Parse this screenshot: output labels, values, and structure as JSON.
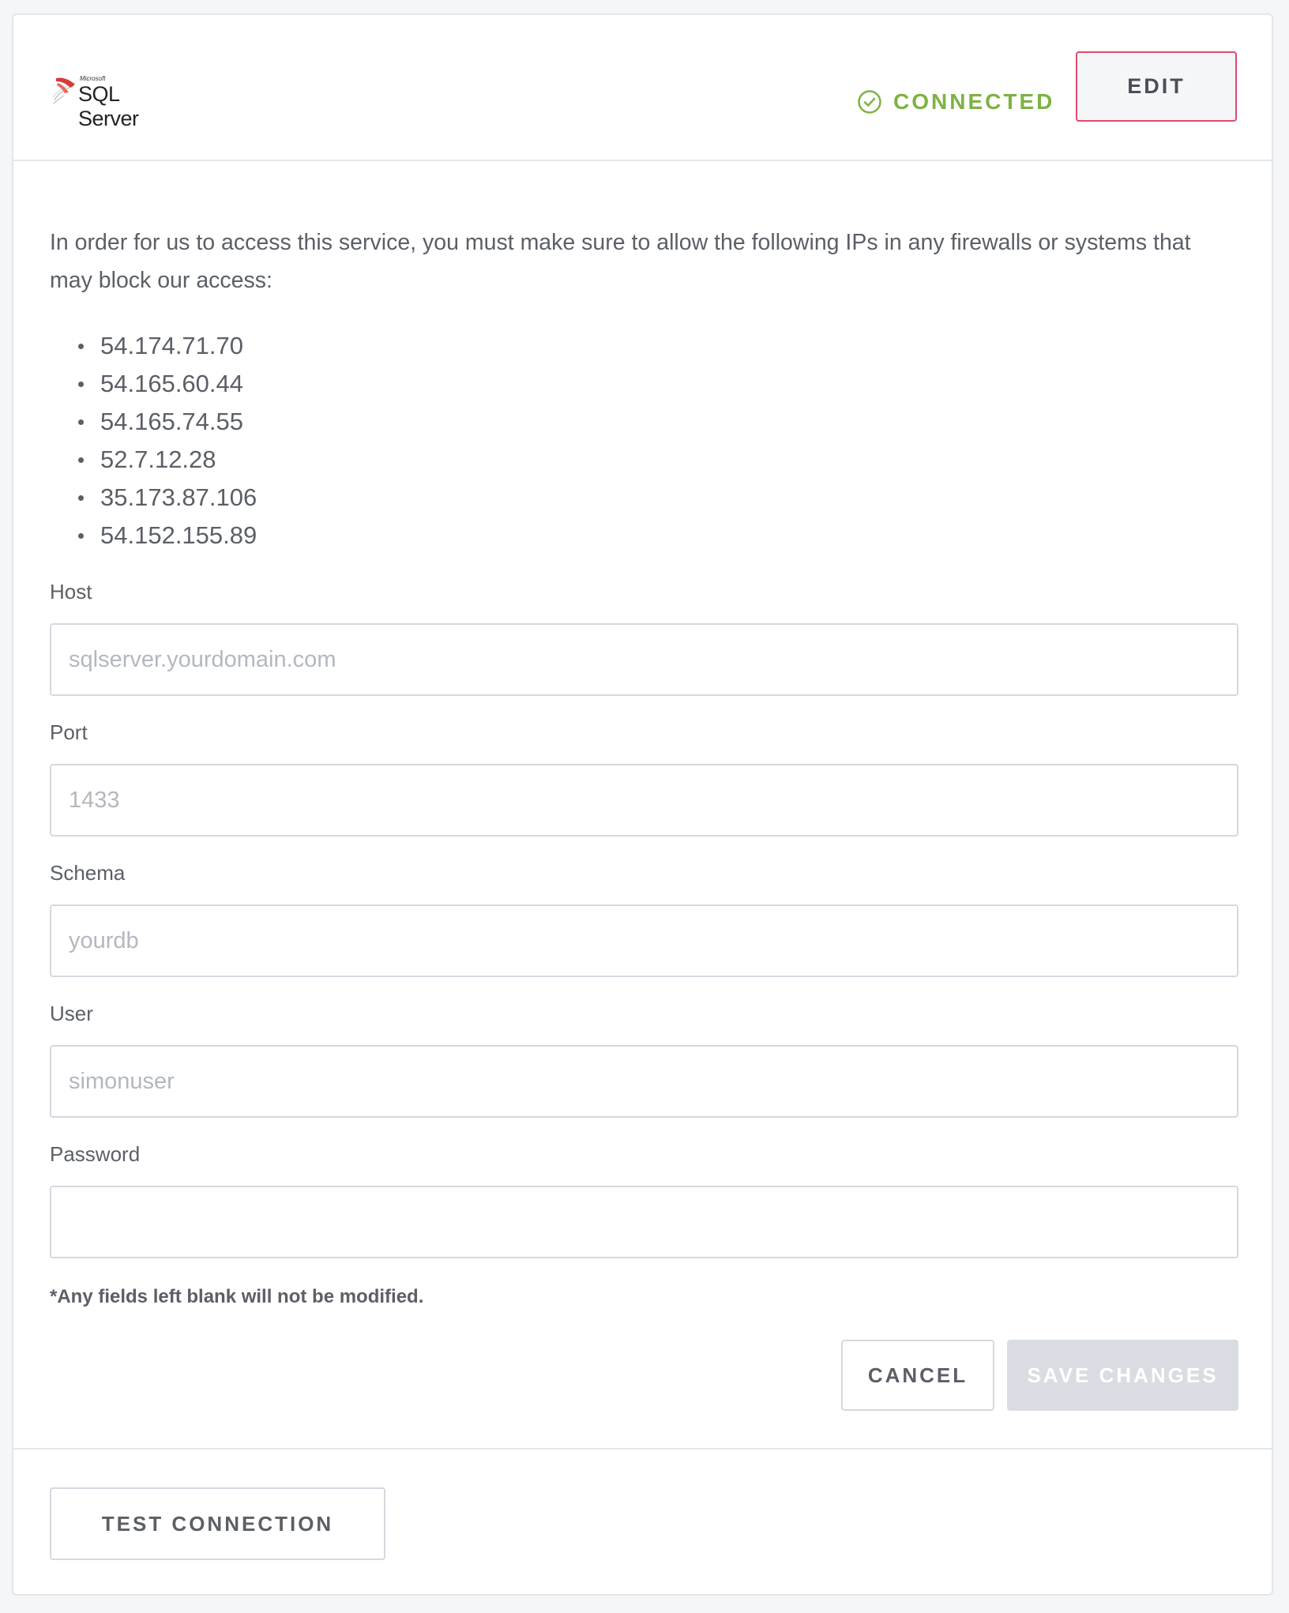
{
  "header": {
    "logo_small": "Microsoft",
    "logo_text": "SQL Server",
    "status_label": "CONNECTED",
    "edit_label": "EDIT"
  },
  "intro": "In order for us to access this service, you must make sure to allow the following IPs in any firewalls or systems that may block our access:",
  "ips": [
    "54.174.71.70",
    "54.165.60.44",
    "54.165.74.55",
    "52.7.12.28",
    "35.173.87.106",
    "54.152.155.89"
  ],
  "fields": {
    "host": {
      "label": "Host",
      "placeholder": "sqlserver.yourdomain.com",
      "value": ""
    },
    "port": {
      "label": "Port",
      "placeholder": "1433",
      "value": ""
    },
    "schema": {
      "label": "Schema",
      "placeholder": "yourdb",
      "value": ""
    },
    "user": {
      "label": "User",
      "placeholder": "simonuser",
      "value": ""
    },
    "password": {
      "label": "Password",
      "placeholder": "",
      "value": ""
    }
  },
  "note": "*Any fields left blank will not be modified.",
  "actions": {
    "cancel_label": "CANCEL",
    "save_label": "SAVE CHANGES",
    "test_label": "TEST CONNECTION"
  },
  "colors": {
    "connected": "#7db342",
    "edit_border": "#e04a6c",
    "save_disabled_bg": "#d9dde3"
  },
  "icons": {
    "status": "check-circle-icon",
    "logo": "sql-server-logo-icon"
  }
}
